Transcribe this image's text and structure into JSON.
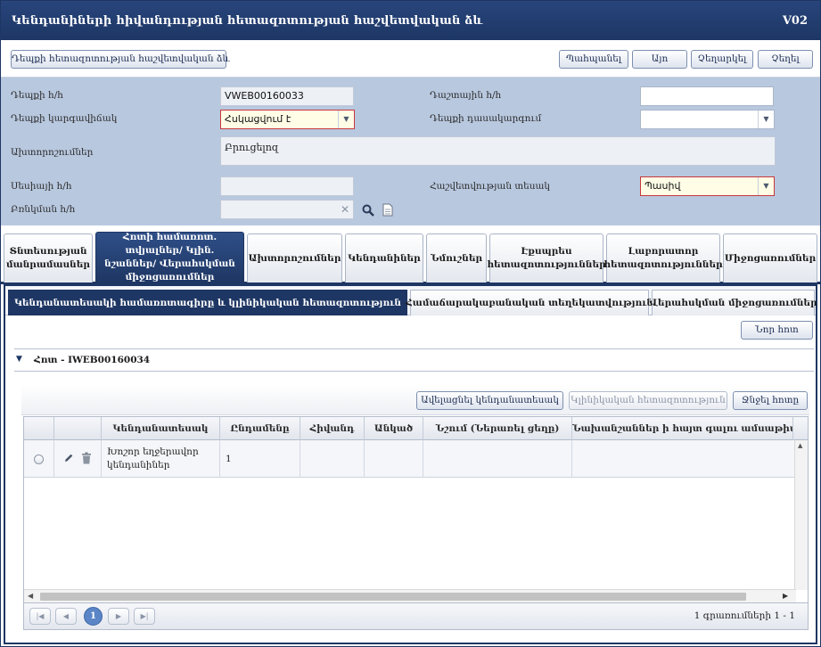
{
  "window": {
    "title": "Կենդանիների հիվանդության հետազոտության հաշվետվական ձև",
    "code": "V02"
  },
  "toolbar": {
    "report_form_label": "Դեպքի հետազոտության հաշվետվական ձև",
    "print_label": "Պահպանել",
    "ok_label": "Այո",
    "cancel_label": "Չեղարկել",
    "close_label": "Չեղել"
  },
  "form": {
    "case_no_label": "Դեպքի հ/հ",
    "case_no_value": "VWEB00160033",
    "field_no_label": "Դաշտային հ/հ",
    "field_no_value": "",
    "case_status_label": "Դեպքի կարգավիճակ",
    "case_status_value": "Հսկացվում է",
    "case_classification_label": "Դեպքի դասակարգում",
    "case_classification_value": "",
    "diagnoses_label": "Ախտորոշումներ",
    "diagnoses_value": "Բրուցելոզ",
    "session_no_label": "Սեսիայի հ/հ",
    "session_no_value": "",
    "report_type_label": "Հաշվետվության տեսակ",
    "report_type_value": "Պասիվ",
    "outbreak_no_label": "Բռնկման հ/հ",
    "outbreak_no_value": "",
    "clear_icon": "clear-x-icon",
    "search_icon": "magnifier-icon",
    "report_icon": "document-icon"
  },
  "tabs": [
    {
      "label": "Տնտեսության մանրամասներ"
    },
    {
      "label": "Հոտի համառոտ. տվյալներ/ Կլին. նշաններ/ Վերահսկման միջոցառումներ"
    },
    {
      "label": "Ախտորոշումներ"
    },
    {
      "label": "Կենդանիներ"
    },
    {
      "label": "Նմուշներ"
    },
    {
      "label": "Էքսպրես հետազոտություններ"
    },
    {
      "label": "Լաբորատոր հետազոտություններ"
    },
    {
      "label": "Միջոցառումներ"
    }
  ],
  "subtabs": [
    {
      "label": "Կենդանատեսակի համառոտագիրը և կլինիկական հետազոտություն"
    },
    {
      "label": "Համաճարակաբանական տեղեկատվություն"
    },
    {
      "label": "Վերահսկման միջոցառումներ"
    }
  ],
  "panel": {
    "new_herd_label": "Նոր հոտ",
    "herd_title": "Հոտ - IWEB00160034",
    "add_species_label": "Ավելացնել կենդանատեսակ",
    "clinical_exam_label": "Կլինիկական հետազոտություն",
    "delete_herd_label": "Ջնջել հոտը"
  },
  "grid": {
    "columns": [
      "",
      "",
      "Կենդանատեսակ",
      "Ընդամենը",
      "Հիվանդ",
      "Անկած",
      "Նշում (Ներառել ցեղը)",
      "Նախանշաններ ի հայտ գալու ամսաթիվ"
    ],
    "rows": [
      {
        "species": "Խոշոր եղջերավոր կենդանիներ",
        "total": "1",
        "sick": "",
        "dead": "",
        "note": "",
        "onset_date": ""
      }
    ]
  },
  "pager": {
    "first_icon": "first-page-icon",
    "prev_icon": "prev-page-icon",
    "current_page": "1",
    "next_icon": "next-page-icon",
    "last_icon": "last-page-icon",
    "info": "1 գրառումների 1 - 1"
  }
}
